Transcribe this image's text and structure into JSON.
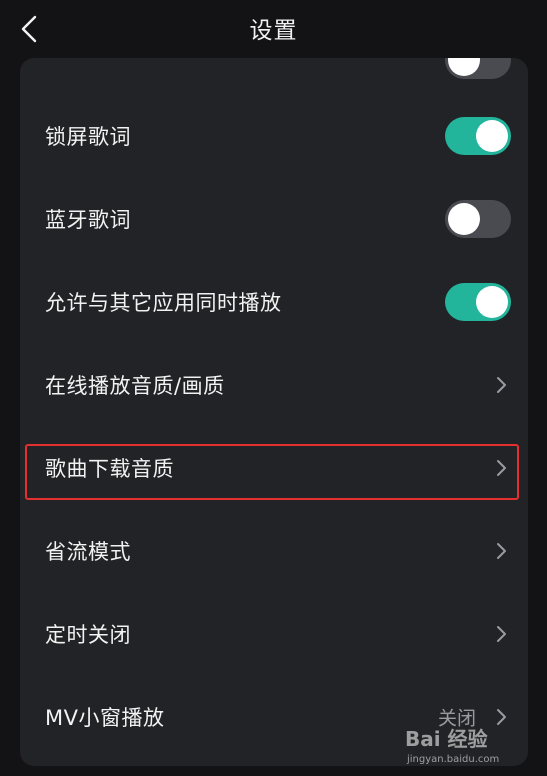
{
  "header": {
    "title": "设置"
  },
  "settings": {
    "items": [
      {
        "label": "锁屏歌词",
        "toggle_on": true
      },
      {
        "label": "蓝牙歌词",
        "toggle_on": false
      },
      {
        "label": "允许与其它应用同时播放",
        "toggle_on": true
      },
      {
        "label": "在线播放音质/画质"
      },
      {
        "label": "歌曲下载音质"
      },
      {
        "label": "省流模式"
      },
      {
        "label": "定时关闭"
      },
      {
        "label": "MV小窗播放",
        "value": "关闭"
      }
    ]
  },
  "colors": {
    "toggle_on": "#22b59c",
    "toggle_off": "#4a4b50",
    "highlight_border": "#e62e2e",
    "card_bg": "#222327"
  },
  "watermark": {
    "text": "Bai 经验",
    "url_text": "jingyan.baidu.com"
  }
}
